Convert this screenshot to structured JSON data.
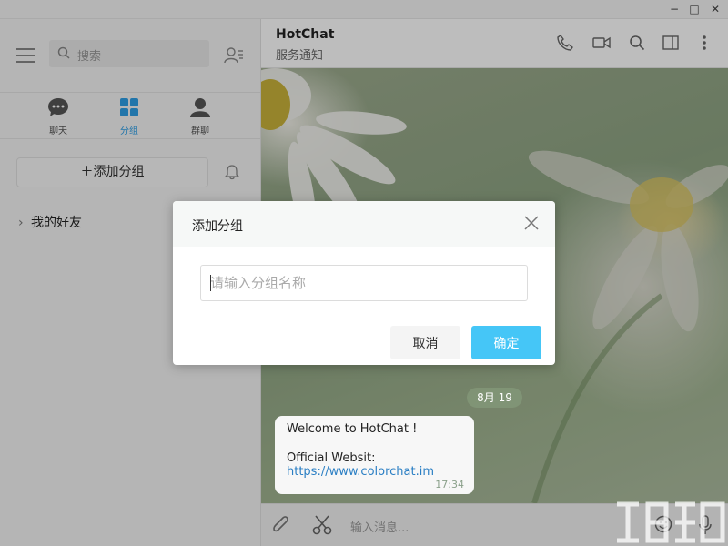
{
  "window": {
    "controls": {
      "minimize": "−",
      "maximize": "□",
      "close": "✕"
    }
  },
  "sidebar": {
    "search_placeholder": "搜索",
    "tabs": [
      {
        "label": "聊天",
        "icon": "chat-bubble-icon"
      },
      {
        "label": "分组",
        "icon": "grid-icon",
        "active": true
      },
      {
        "label": "群聊",
        "icon": "group-icon"
      }
    ],
    "add_group_label": "添加分组",
    "groups": [
      {
        "label": "我的好友"
      }
    ]
  },
  "chat": {
    "title": "HotChat",
    "subtitle": "服务通知",
    "header_icons": [
      "phone-icon",
      "video-icon",
      "search-icon",
      "panel-icon",
      "more-icon"
    ],
    "date": "8月 19",
    "message": {
      "line1": "Welcome to HotChat !",
      "line2": "Official Websit:",
      "link": "https://www.colorchat.im",
      "time": "17:34"
    },
    "composer_placeholder": "输入消息..."
  },
  "dialog": {
    "title": "添加分组",
    "input_placeholder": "请输入分组名称",
    "cancel_label": "取消",
    "confirm_label": "确定"
  },
  "colors": {
    "accent": "#45c6f7",
    "active_tab": "#2d9ee6",
    "link": "#2b7fc4"
  }
}
